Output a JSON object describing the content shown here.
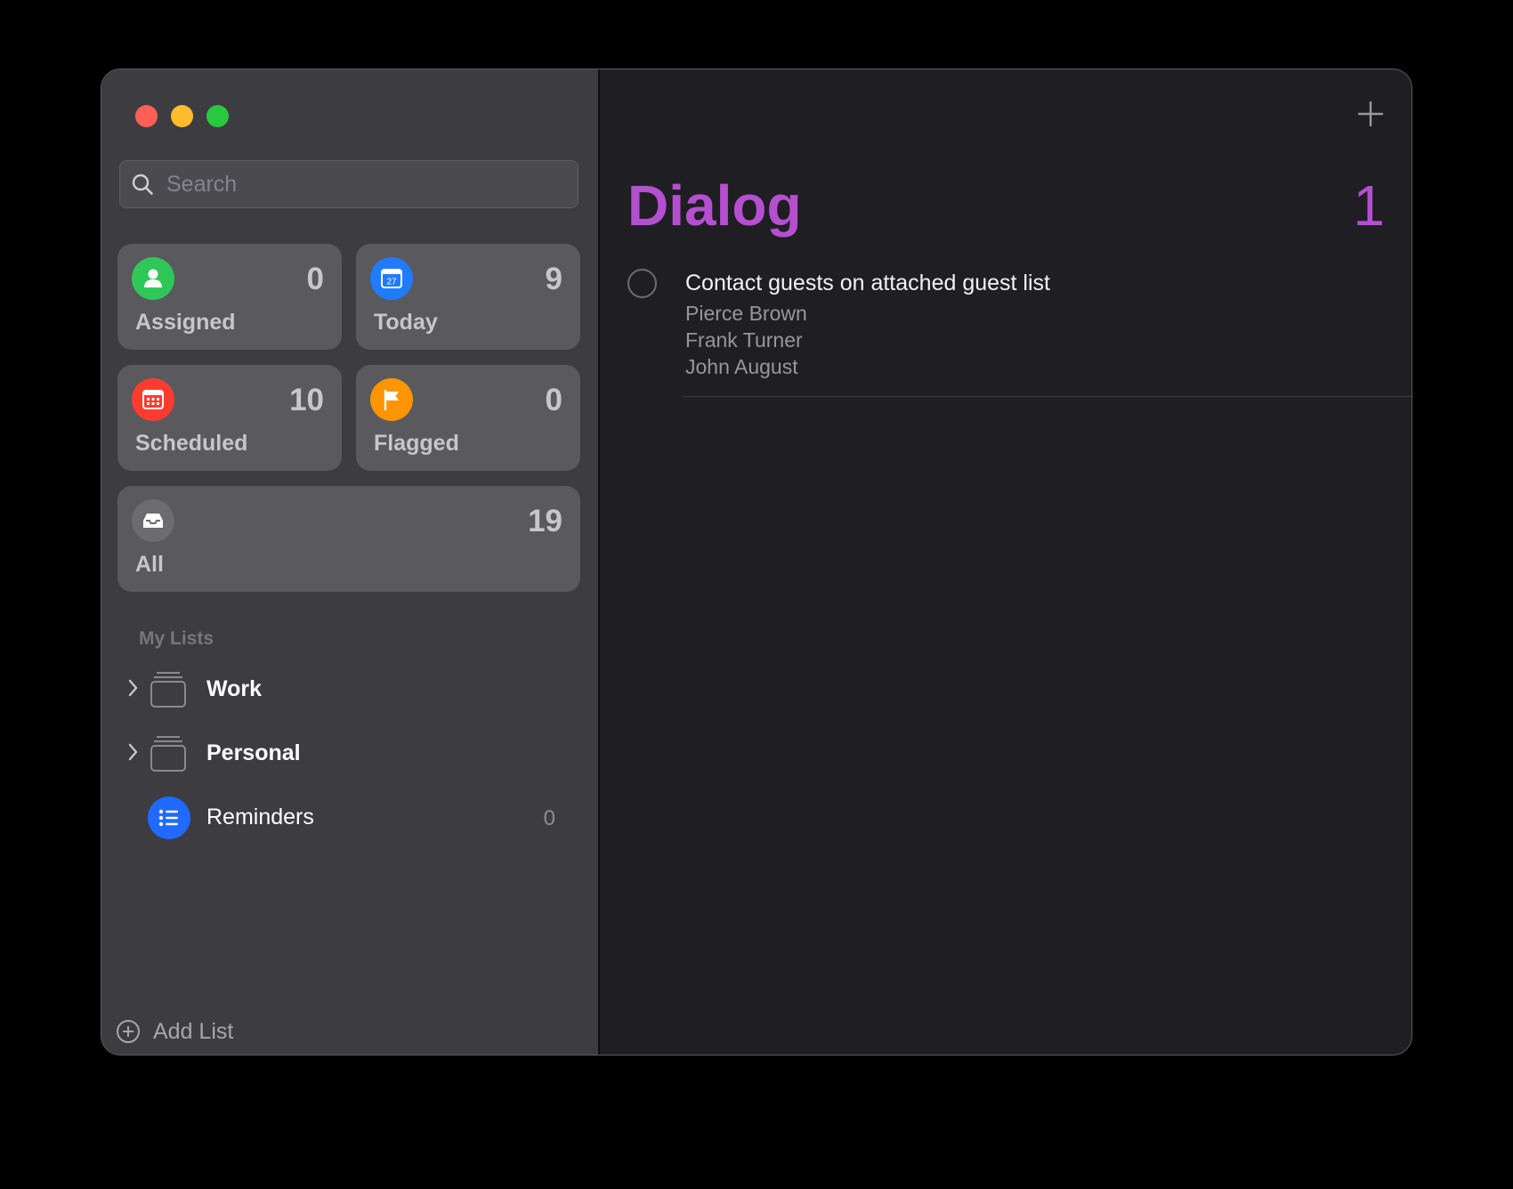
{
  "search": {
    "placeholder": "Search"
  },
  "smart_lists": {
    "assigned": {
      "label": "Assigned",
      "count": "0",
      "color": "#30c759"
    },
    "today": {
      "label": "Today",
      "count": "9",
      "icon_text": "27",
      "color": "#1f7cff"
    },
    "scheduled": {
      "label": "Scheduled",
      "count": "10",
      "color": "#ff3b30"
    },
    "flagged": {
      "label": "Flagged",
      "count": "0",
      "color": "#ff9500"
    },
    "all": {
      "label": "All",
      "count": "19",
      "color": "#6c6b70"
    }
  },
  "my_lists": {
    "heading": "My Lists",
    "items": [
      {
        "name": "Work",
        "type": "group"
      },
      {
        "name": "Personal",
        "type": "group"
      },
      {
        "name": "Reminders",
        "type": "list",
        "count": "0",
        "color": "#1f6bff"
      }
    ]
  },
  "footer": {
    "add_list_label": "Add List"
  },
  "main": {
    "title": "Dialog",
    "count": "1",
    "accent_color": "#b44fcf",
    "tasks": [
      {
        "title": "Contact guests on attached guest list",
        "notes": [
          "Pierce Brown",
          "Frank Turner",
          "John August"
        ]
      }
    ]
  }
}
